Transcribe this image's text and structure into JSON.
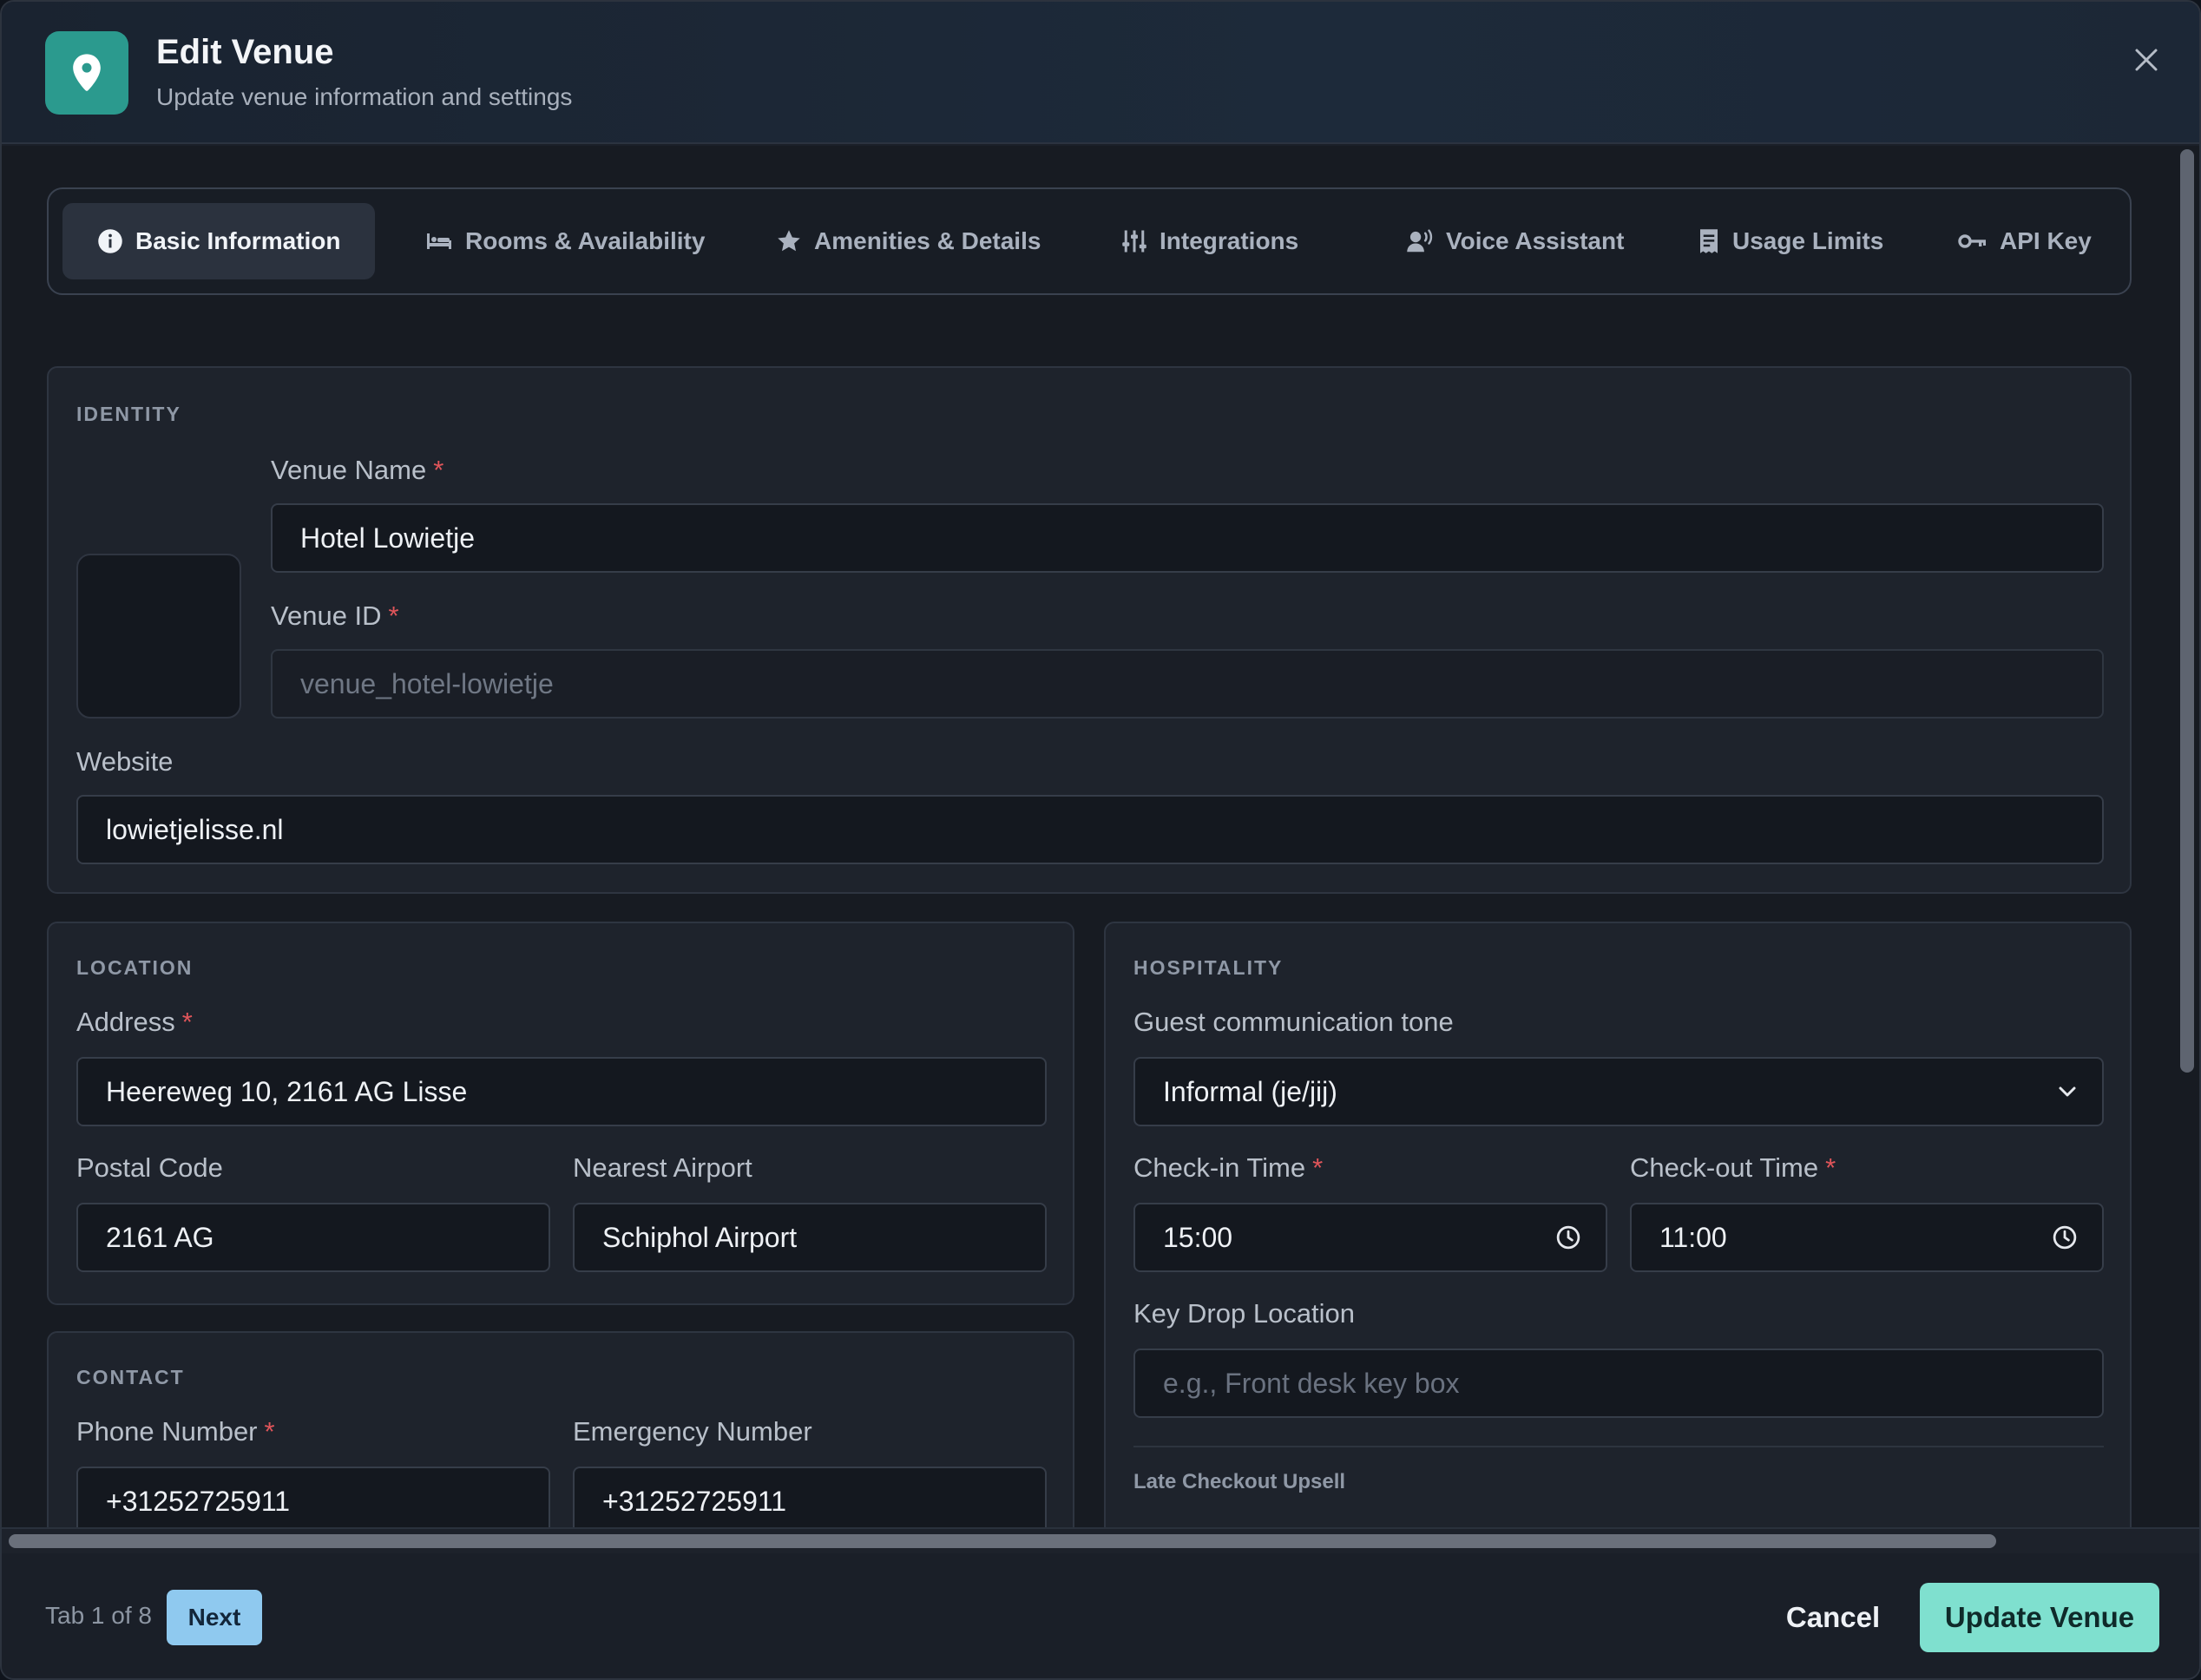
{
  "header": {
    "title": "Edit Venue",
    "subtitle": "Update venue information and settings",
    "icon": "map-pin-icon",
    "accent": "#2b9a8e"
  },
  "tabs": [
    {
      "label": "Basic Information",
      "icon": "info-icon",
      "active": true
    },
    {
      "label": "Rooms & Availability",
      "icon": "bed-icon"
    },
    {
      "label": "Amenities & Details",
      "icon": "star-icon"
    },
    {
      "label": "Integrations",
      "icon": "sliders-icon"
    },
    {
      "label": "Voice Assistant",
      "icon": "voice-icon"
    },
    {
      "label": "Usage Limits",
      "icon": "receipt-icon"
    },
    {
      "label": "API Key",
      "icon": "key-icon"
    },
    {
      "label": "",
      "icon": "lock-icon"
    }
  ],
  "identity": {
    "title": "IDENTITY",
    "venue_name_label": "Venue Name",
    "venue_name_value": "Hotel Lowietje",
    "venue_id_label": "Venue ID",
    "venue_id_value": "venue_hotel-lowietje",
    "website_label": "Website",
    "website_value": "lowietjelisse.nl",
    "required_mark": "*"
  },
  "location": {
    "title": "LOCATION",
    "address_label": "Address",
    "address_value": "Heereweg 10, 2161 AG Lisse",
    "postal_label": "Postal Code",
    "postal_value": "2161 AG",
    "airport_label": "Nearest Airport",
    "airport_value": "Schiphol Airport"
  },
  "contact": {
    "title": "CONTACT",
    "phone_label": "Phone Number",
    "phone_value": "+31252725911",
    "emergency_label": "Emergency Number",
    "emergency_value": "+31252725911"
  },
  "hospitality": {
    "title": "HOSPITALITY",
    "tone_label": "Guest communication tone",
    "tone_value": "Informal (je/jij)",
    "checkin_label": "Check-in Time",
    "checkin_value": "15:00",
    "checkout_label": "Check-out Time",
    "checkout_value": "11:00",
    "keydrop_label": "Key Drop Location",
    "keydrop_placeholder": "e.g., Front desk key box",
    "late_checkout_heading": "Late Checkout Upsell"
  },
  "footer": {
    "tab_counter": "Tab 1 of 8",
    "next_label": "Next",
    "cancel_label": "Cancel",
    "update_label": "Update Venue"
  }
}
